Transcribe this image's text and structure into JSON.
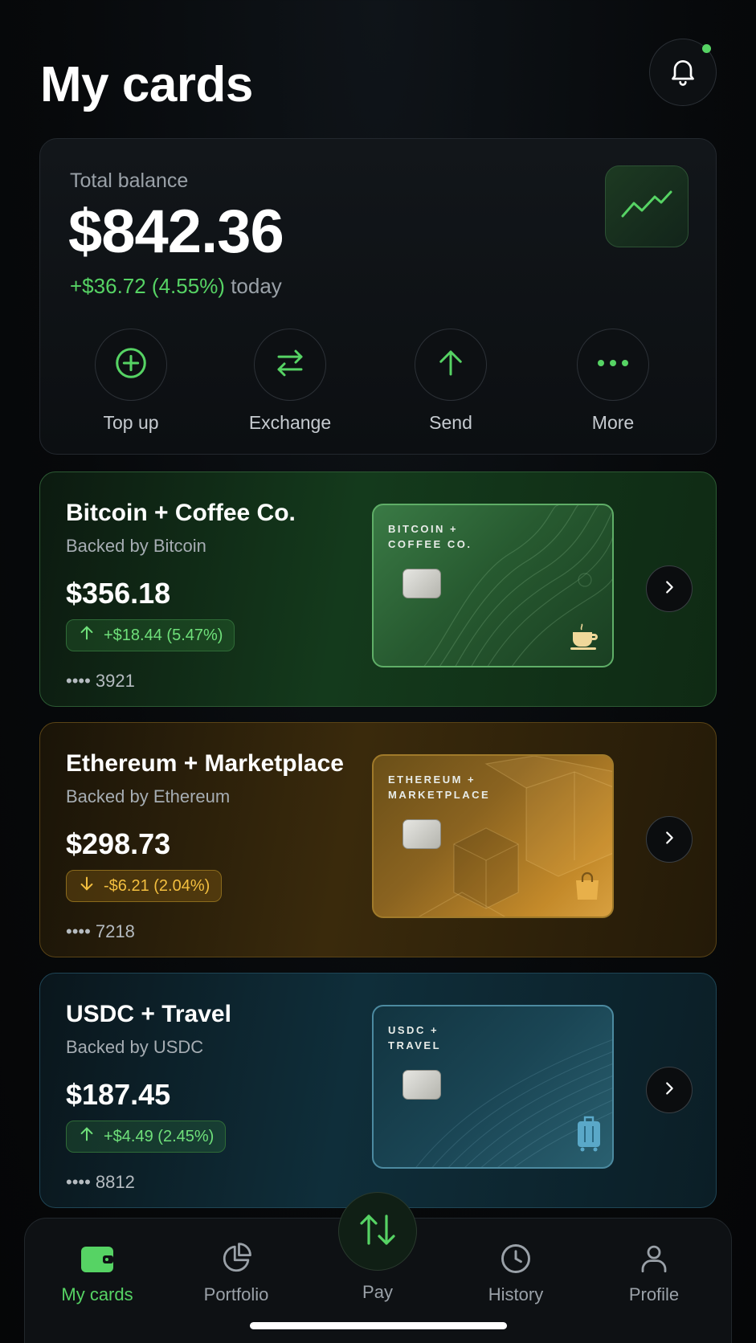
{
  "header": {
    "title": "My cards"
  },
  "balance": {
    "label": "Total balance",
    "amount": "$842.36",
    "change_value": "+$36.72 (4.55%)",
    "change_suffix": "today"
  },
  "actions": [
    {
      "label": "Top up",
      "icon": "plus-circle-icon"
    },
    {
      "label": "Exchange",
      "icon": "swap-arrows-icon"
    },
    {
      "label": "Send",
      "icon": "arrow-up-icon"
    },
    {
      "label": "More",
      "icon": "more-dots-icon"
    }
  ],
  "cards": [
    {
      "name": "Bitcoin + Coffee Co.",
      "backed": "Backed by Bitcoin",
      "amount": "$356.18",
      "change": "+$18.44 (5.47%)",
      "direction": "up",
      "number": "•••• 3921",
      "mini_title_line1": "BITCOIN +",
      "mini_title_line2": "COFFEE CO.",
      "icon": "coffee-cup-icon",
      "accent": "#56d364"
    },
    {
      "name": "Ethereum + Marketplace",
      "backed": "Backed by Ethereum",
      "amount": "$298.73",
      "change": "-$6.21 (2.04%)",
      "direction": "down",
      "number": "•••• 7218",
      "mini_title_line1": "ETHEREUM +",
      "mini_title_line2": "MARKETPLACE",
      "icon": "shopping-bag-icon",
      "accent": "#f3bf3f"
    },
    {
      "name": "USDC + Travel",
      "backed": "Backed by USDC",
      "amount": "$187.45",
      "change": "+$4.49 (2.45%)",
      "direction": "up",
      "number": "•••• 8812",
      "mini_title_line1": "USDC +",
      "mini_title_line2": "TRAVEL",
      "icon": "suitcase-icon",
      "accent": "#5aa8c8"
    }
  ],
  "tabs": [
    {
      "label": "My cards",
      "icon": "wallet-icon",
      "active": true
    },
    {
      "label": "Portfolio",
      "icon": "pie-chart-icon",
      "active": false
    },
    {
      "label": "Pay",
      "icon": "transfer-arrows-icon",
      "active": false
    },
    {
      "label": "History",
      "icon": "clock-icon",
      "active": false
    },
    {
      "label": "Profile",
      "icon": "user-icon",
      "active": false
    }
  ],
  "colors": {
    "accent_green": "#56d364",
    "accent_gold": "#f3bf3f",
    "background": "#07090b"
  }
}
